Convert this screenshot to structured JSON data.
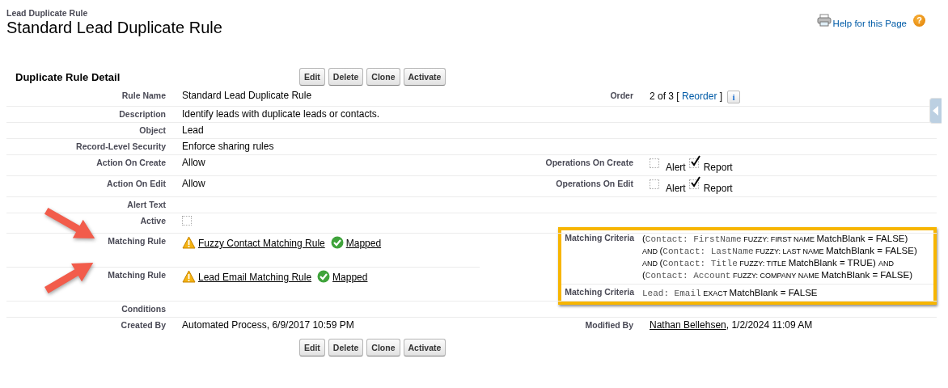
{
  "breadcrumb": "Lead Duplicate Rule",
  "title": "Standard Lead Duplicate Rule",
  "help": {
    "link": "Help for this Page",
    "icon": "?"
  },
  "detail": {
    "title": "Duplicate Rule Detail",
    "buttons": [
      "Edit",
      "Delete",
      "Clone",
      "Activate"
    ],
    "rows": [
      {
        "left": {
          "label": "Rule Name",
          "kind": "text",
          "value": "Standard Lead Duplicate Rule"
        },
        "right": {
          "label": "Order",
          "kind": "order",
          "before": "2 of 3 [",
          "link": "Reorder",
          "after": "]",
          "info": "i"
        }
      },
      {
        "left": {
          "label": "Description",
          "kind": "text",
          "value": "Identify leads with duplicate leads or contacts."
        }
      },
      {
        "left": {
          "label": "Object",
          "kind": "text",
          "value": "Lead"
        }
      },
      {
        "left": {
          "label": "Record-Level Security",
          "kind": "text",
          "value": "Enforce sharing rules"
        }
      },
      {
        "left": {
          "label": "Action On Create",
          "kind": "text",
          "value": "Allow"
        },
        "right": {
          "label": "Operations On Create",
          "kind": "checks",
          "options": [
            {
              "label": "Alert",
              "checked": false
            },
            {
              "label": "Report",
              "checked": true
            }
          ]
        }
      },
      {
        "left": {
          "label": "Action On Edit",
          "kind": "text",
          "value": "Allow"
        },
        "right": {
          "label": "Operations On Edit",
          "kind": "checks",
          "options": [
            {
              "label": "Alert",
              "checked": false
            },
            {
              "label": "Report",
              "checked": true
            }
          ]
        }
      },
      {
        "left": {
          "label": "Alert Text",
          "kind": "text"
        }
      },
      {
        "left": {
          "label": "Active",
          "kind": "checkbox",
          "checked": false
        }
      },
      {
        "pointed": true,
        "left": {
          "label": "Matching Rule",
          "kind": "rule",
          "warning": true,
          "link": "Fuzzy Contact Matching Rule",
          "status": "Mapped"
        },
        "right": {
          "kind": "criteria",
          "highlighted": true,
          "items": [
            {
              "label": "Matching Criteria",
              "lines": [
                [
                  {
                    "kind": "plain",
                    "text": "("
                  },
                  {
                    "kind": "mono",
                    "text": "Contact: FirstName"
                  },
                  {
                    "kind": "small",
                    "text": " FUZZY: FIRST NAME "
                  },
                  {
                    "kind": "plain",
                    "text": "MatchBlank = FALSE)"
                  }
                ],
                [
                  {
                    "kind": "small",
                    "text": "AND "
                  },
                  {
                    "kind": "plain",
                    "text": "("
                  },
                  {
                    "kind": "mono",
                    "text": "Contact: LastName"
                  },
                  {
                    "kind": "small",
                    "text": " FUZZY: LAST NAME "
                  },
                  {
                    "kind": "plain",
                    "text": "MatchBlank = FALSE)"
                  }
                ],
                [
                  {
                    "kind": "small",
                    "text": "AND "
                  },
                  {
                    "kind": "plain",
                    "text": "("
                  },
                  {
                    "kind": "mono",
                    "text": "Contact: Title"
                  },
                  {
                    "kind": "small",
                    "text": " FUZZY: TITLE "
                  },
                  {
                    "kind": "plain",
                    "text": "MatchBlank = TRUE) "
                  },
                  {
                    "kind": "small",
                    "text": "AND"
                  }
                ],
                [
                  {
                    "kind": "plain",
                    "text": "("
                  },
                  {
                    "kind": "mono",
                    "text": "Contact: Account"
                  },
                  {
                    "kind": "small",
                    "text": " FUZZY: COMPANY NAME "
                  },
                  {
                    "kind": "plain",
                    "text": "MatchBlank = FALSE)"
                  }
                ]
              ]
            },
            {
              "label": "Matching Criteria",
              "lines": [
                [
                  {
                    "kind": "mono",
                    "text": "Lead: Email"
                  },
                  {
                    "kind": "small",
                    "text": " EXACT "
                  },
                  {
                    "kind": "plain",
                    "text": "MatchBlank = FALSE"
                  }
                ]
              ]
            }
          ]
        }
      },
      {
        "pointed": true,
        "left": {
          "label": "Matching Rule",
          "kind": "rule",
          "warning": true,
          "link": "Lead Email Matching Rule",
          "status": "Mapped"
        }
      },
      {
        "left": {
          "label": "Conditions",
          "kind": "text"
        }
      },
      {
        "left": {
          "label": "Created By",
          "kind": "text",
          "value": "Automated Process, 6/9/2017 10:59 PM"
        },
        "right": {
          "label": "Modified By",
          "kind": "user",
          "link": "Nathan Bellehsen",
          "after": ", 1/2/2024 11:09 AM"
        }
      }
    ],
    "bottom_buttons": [
      "Edit",
      "Delete",
      "Clone",
      "Activate"
    ]
  }
}
